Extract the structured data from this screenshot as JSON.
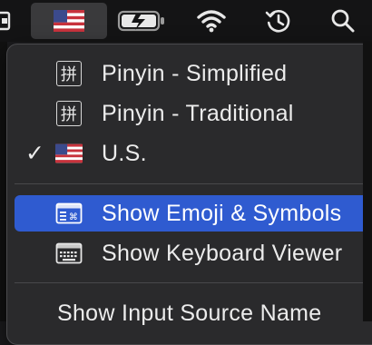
{
  "menubar": {
    "icons": {
      "input_source": "us-flag-icon",
      "battery": "battery-charging-icon",
      "wifi": "wifi-icon",
      "time_machine": "time-machine-icon",
      "spotlight": "search-icon"
    }
  },
  "menu": {
    "items": [
      {
        "label": "Pinyin - Simplified",
        "icon": "拼",
        "checked": false
      },
      {
        "label": "Pinyin - Traditional",
        "icon": "拼",
        "checked": false
      },
      {
        "label": "U.S.",
        "icon": "us-flag-icon",
        "checked": true,
        "check_mark": "✓"
      }
    ],
    "actions": [
      {
        "label": "Show Emoji & Symbols",
        "icon": "emoji-symbols-icon",
        "selected": true
      },
      {
        "label": "Show Keyboard Viewer",
        "icon": "keyboard-icon",
        "selected": false
      }
    ],
    "footer_label": "Show Input Source Name"
  },
  "colors": {
    "highlight": "#2f5bd0",
    "menu_bg": "#2a2a2c"
  }
}
